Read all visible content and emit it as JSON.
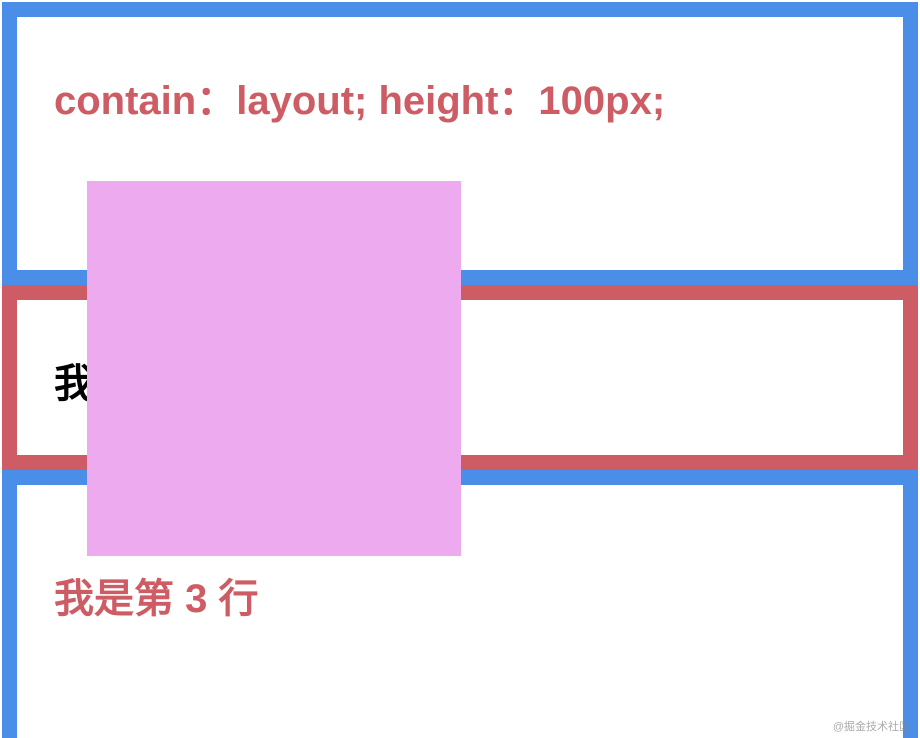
{
  "box1": {
    "title": "contain：layout; height：100px;"
  },
  "box2": {
    "title": "我"
  },
  "box3": {
    "title": "我是第 3 行"
  },
  "watermark": "@掘金技术社区"
}
